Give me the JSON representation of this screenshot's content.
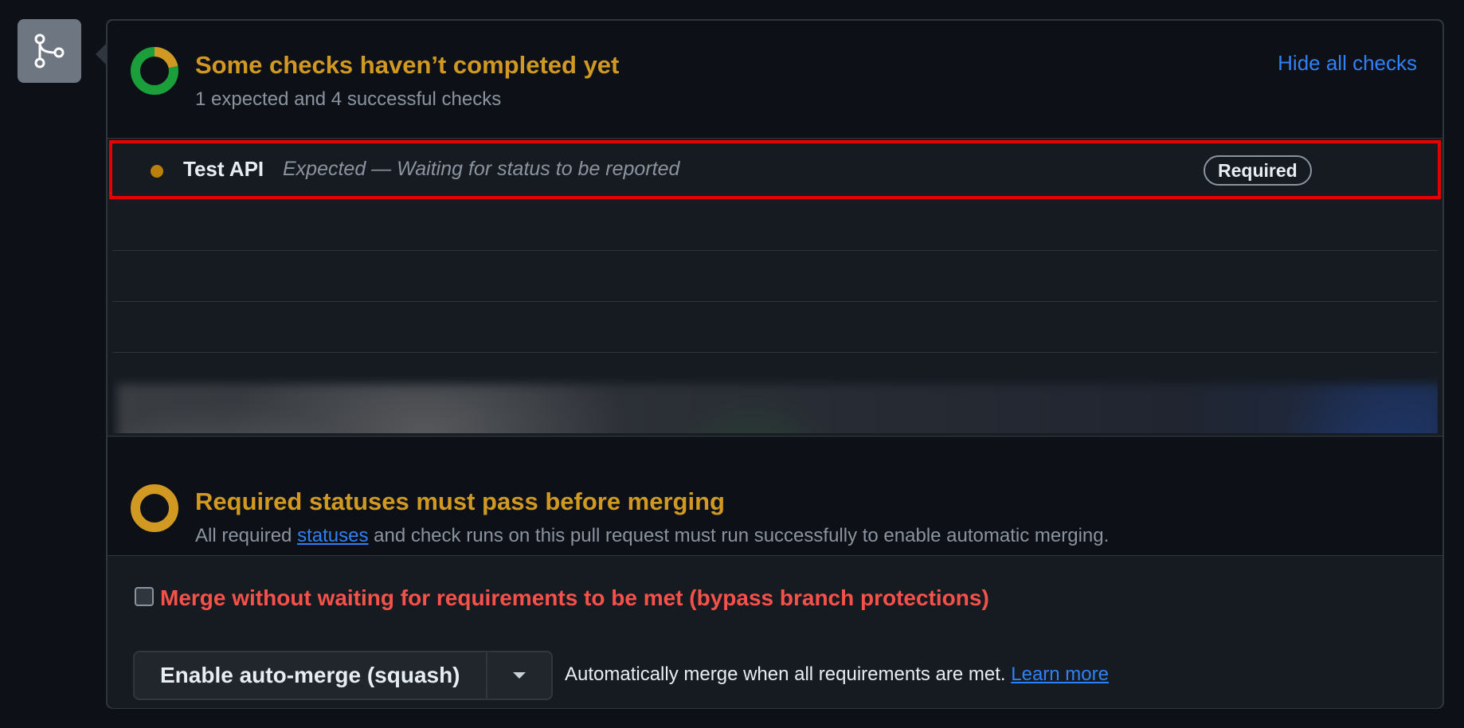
{
  "icons": {
    "branch": "git-merge-icon",
    "donut": "checks-progress-icon",
    "ring": "pending-ring-icon",
    "dropdown": "caret-down-icon"
  },
  "colors": {
    "pending": "#d29922",
    "success": "#1a9f3a",
    "link": "#2f81f7",
    "danger": "#f85149",
    "highlight_border": "#e60000"
  },
  "checks_header": {
    "title": "Some checks haven’t completed yet",
    "subtitle": "1 expected and 4 successful checks",
    "hide_link": "Hide all checks"
  },
  "check_row": {
    "name": "Test API",
    "description": "Expected — Waiting for status to be reported",
    "badge": "Required"
  },
  "required_status": {
    "title": "Required statuses must pass before merging",
    "desc_before": "All required ",
    "desc_link": "statuses",
    "desc_after": " and check runs on this pull request must run successfully to enable automatic merging."
  },
  "merge": {
    "bypass_label": "Merge without waiting for requirements to be met (bypass branch protections)",
    "bypass_checked": false,
    "automerge_button": "Enable auto-merge (squash)",
    "note": "Automatically merge when all requirements are met. ",
    "learn_more": "Learn more"
  }
}
